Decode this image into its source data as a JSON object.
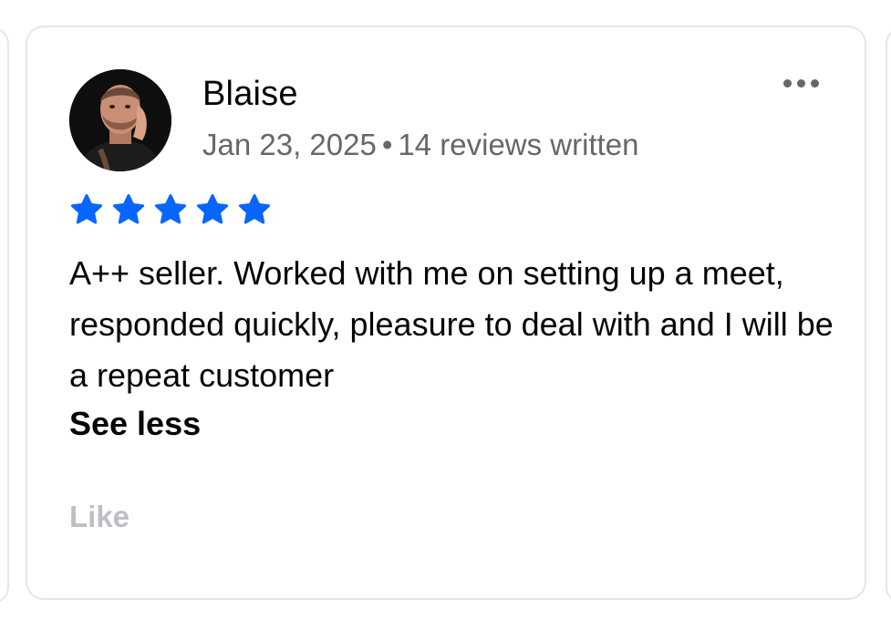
{
  "review": {
    "reviewer_name": "Blaise",
    "date": "Jan 23, 2025",
    "separator": "•",
    "reviews_written": "14 reviews written",
    "rating": 5,
    "rating_max": 5,
    "star_color": "#0866ff",
    "text": "A++ seller. Worked with me on setting up a meet, responded quickly, pleasure to deal with and I will be a repeat customer",
    "see_less_label": "See less",
    "like_label": "Like",
    "more_icon": "more-horizontal-icon",
    "star_icon": "star-icon"
  }
}
